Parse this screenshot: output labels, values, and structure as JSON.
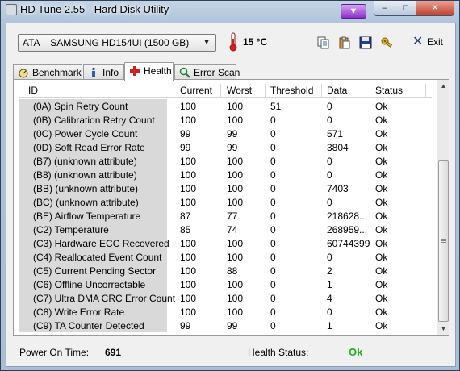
{
  "window": {
    "title": "HD Tune 2.55 - Hard Disk Utility"
  },
  "toolbar": {
    "drive": "ATA    SAMSUNG HD154UI (1500 GB)",
    "temperature": "15 °C",
    "exit_label": "Exit"
  },
  "tabs": [
    {
      "label": "Benchmark",
      "icon": "gauge-icon"
    },
    {
      "label": "Info",
      "icon": "info-icon"
    },
    {
      "label": "Health",
      "icon": "health-cross-icon",
      "active": true
    },
    {
      "label": "Error Scan",
      "icon": "magnifier-icon"
    }
  ],
  "table": {
    "columns": [
      "ID",
      "Current",
      "Worst",
      "Threshold",
      "Data",
      "Status"
    ],
    "rows": [
      [
        "(0A) Spin Retry Count",
        "100",
        "100",
        "51",
        "0",
        "Ok"
      ],
      [
        "(0B) Calibration Retry Count",
        "100",
        "100",
        "0",
        "0",
        "Ok"
      ],
      [
        "(0C) Power Cycle Count",
        "99",
        "99",
        "0",
        "571",
        "Ok"
      ],
      [
        "(0D) Soft Read Error Rate",
        "99",
        "99",
        "0",
        "3804",
        "Ok"
      ],
      [
        "(B7) (unknown attribute)",
        "100",
        "100",
        "0",
        "0",
        "Ok"
      ],
      [
        "(B8) (unknown attribute)",
        "100",
        "100",
        "0",
        "0",
        "Ok"
      ],
      [
        "(BB) (unknown attribute)",
        "100",
        "100",
        "0",
        "7403",
        "Ok"
      ],
      [
        "(BC) (unknown attribute)",
        "100",
        "100",
        "0",
        "0",
        "Ok"
      ],
      [
        "(BE) Airflow Temperature",
        "87",
        "77",
        "0",
        "218628...",
        "Ok"
      ],
      [
        "(C2) Temperature",
        "85",
        "74",
        "0",
        "268959...",
        "Ok"
      ],
      [
        "(C3) Hardware ECC Recovered",
        "100",
        "100",
        "0",
        "60744399",
        "Ok"
      ],
      [
        "(C4) Reallocated Event Count",
        "100",
        "100",
        "0",
        "0",
        "Ok"
      ],
      [
        "(C5) Current Pending Sector",
        "100",
        "88",
        "0",
        "2",
        "Ok"
      ],
      [
        "(C6) Offline Uncorrectable",
        "100",
        "100",
        "0",
        "1",
        "Ok"
      ],
      [
        "(C7) Ultra DMA CRC Error Count",
        "100",
        "100",
        "0",
        "4",
        "Ok"
      ],
      [
        "(C8) Write Error Rate",
        "100",
        "100",
        "0",
        "0",
        "Ok"
      ],
      [
        "(C9) TA Counter Detected",
        "99",
        "99",
        "0",
        "1",
        "Ok"
      ]
    ]
  },
  "status": {
    "power_on_label": "Power On Time:",
    "power_on_value": "691",
    "health_label": "Health Status:",
    "health_value": "Ok",
    "health_color": "#1eae1e"
  }
}
